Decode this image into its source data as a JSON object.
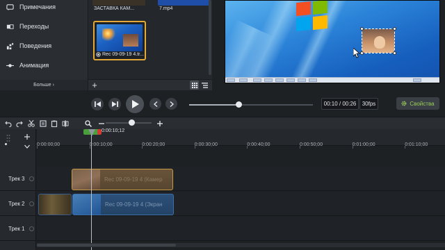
{
  "tools": {
    "items": [
      {
        "label": "Примечания",
        "icon": "annotations-icon"
      },
      {
        "label": "Переходы",
        "icon": "transitions-icon"
      },
      {
        "label": "Поведения",
        "icon": "behaviors-icon"
      },
      {
        "label": "Анимация",
        "icon": "animation-icon"
      }
    ],
    "more_label": "Больше ›"
  },
  "media_bin": {
    "clips": [
      {
        "caption": "ЗАСТАВКА КАМ..."
      },
      {
        "caption": "7.mp4"
      },
      {
        "caption": "Rec 09-09-19 4.tr..."
      }
    ],
    "add_label": "+"
  },
  "canvas": {
    "properties_label": "Свойства",
    "accent": "#9acd5a"
  },
  "transport": {
    "timecode": "00:10 / 00:26",
    "fps": "30fps",
    "progress": 0.4
  },
  "timeline": {
    "playhead_time": "0:00:10;12",
    "ruler_ticks": [
      "0:00:00;00",
      "0:00:10;00",
      "0:00:20;00",
      "0:00:30;00",
      "0:00:40;00",
      "0:00:50;00",
      "0:01:00;00",
      "0:01:10;00"
    ],
    "tracks": [
      {
        "name": "Трек 3"
      },
      {
        "name": "Трек 2"
      },
      {
        "name": "Трек 1"
      }
    ],
    "media": {
      "camera_clip": "Rec 09-09-19 4 (Камер",
      "screen_clip": "Rec 09-09-19 4 (Экран"
    }
  }
}
